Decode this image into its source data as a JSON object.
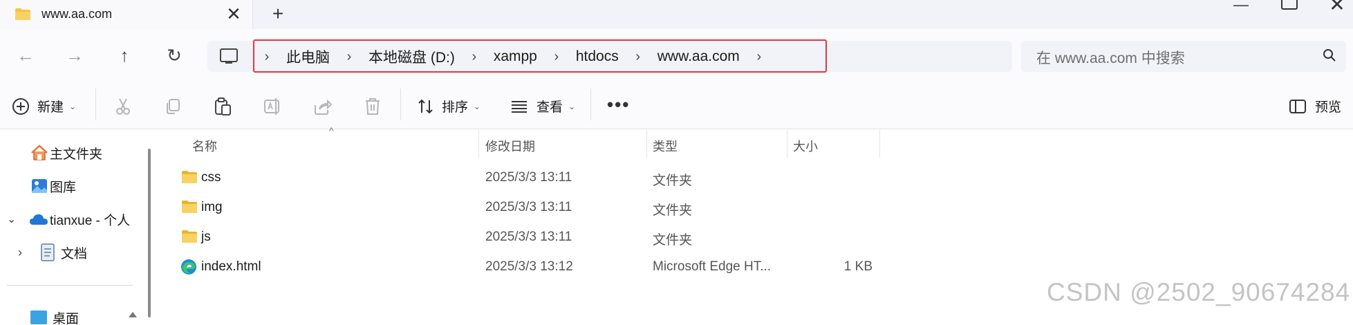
{
  "tab": {
    "title": "www.aa.com",
    "close": "✕",
    "new_tab": "+"
  },
  "window": {
    "minimize": "—",
    "close": "✕"
  },
  "nav": {
    "back": "←",
    "forward": "→",
    "up": "↑",
    "refresh": "↻"
  },
  "breadcrumb": {
    "separator": "›",
    "items": [
      "此电脑",
      "本地磁盘 (D:)",
      "xampp",
      "htdocs",
      "www.aa.com"
    ]
  },
  "search": {
    "placeholder": "在 www.aa.com 中搜索"
  },
  "commands": {
    "new": "新建",
    "sort": "排序",
    "view": "查看",
    "more": "•••",
    "preview": "预览"
  },
  "sidebar": {
    "items": [
      {
        "label": "主文件夹",
        "icon": "home-icon"
      },
      {
        "label": "图库",
        "icon": "gallery-icon"
      },
      {
        "label": "tianxue - 个人",
        "icon": "onedrive-cloud-icon",
        "expanded": true
      },
      {
        "label": "文档",
        "icon": "document-icon",
        "expanded": false
      },
      {
        "label": "桌面",
        "icon": "desktop-icon"
      }
    ]
  },
  "columns": {
    "name": "名称",
    "modified": "修改日期",
    "type": "类型",
    "size": "大小"
  },
  "files": [
    {
      "name": "css",
      "modified": "2025/3/3 13:11",
      "type": "文件夹",
      "size": "",
      "icon": "folder-icon"
    },
    {
      "name": "img",
      "modified": "2025/3/3 13:11",
      "type": "文件夹",
      "size": "",
      "icon": "folder-icon"
    },
    {
      "name": "js",
      "modified": "2025/3/3 13:11",
      "type": "文件夹",
      "size": "",
      "icon": "folder-icon"
    },
    {
      "name": "index.html",
      "modified": "2025/3/3 13:12",
      "type": "Microsoft Edge HT...",
      "size": "1 KB",
      "icon": "edge-html-icon"
    }
  ],
  "watermark": "CSDN @2502_90674284",
  "colors": {
    "highlight": "#e0393e",
    "folder": "#f4c542",
    "onedrive": "#1e78d6"
  }
}
